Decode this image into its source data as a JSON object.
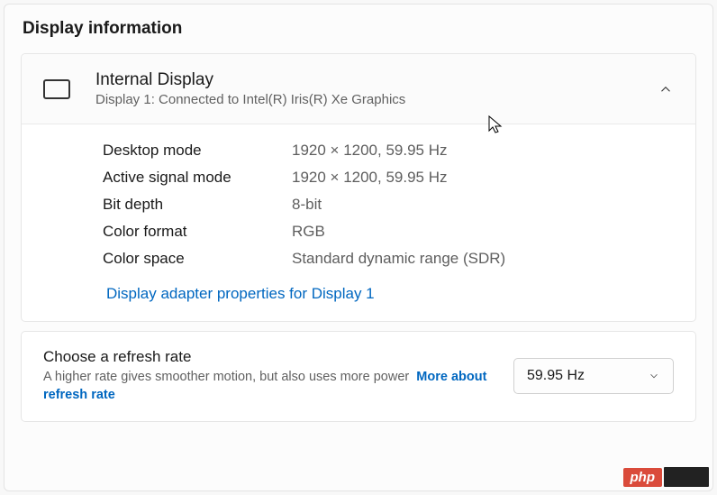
{
  "section_title": "Display information",
  "display": {
    "title": "Internal Display",
    "subtitle": "Display 1: Connected to Intel(R) Iris(R) Xe Graphics",
    "properties": [
      {
        "label": "Desktop mode",
        "value": "1920 × 1200, 59.95 Hz"
      },
      {
        "label": "Active signal mode",
        "value": "1920 × 1200, 59.95 Hz"
      },
      {
        "label": "Bit depth",
        "value": "8-bit"
      },
      {
        "label": "Color format",
        "value": "RGB"
      },
      {
        "label": "Color space",
        "value": "Standard dynamic range (SDR)"
      }
    ],
    "adapter_link": "Display adapter properties for Display 1"
  },
  "refresh": {
    "title": "Choose a refresh rate",
    "description": "A higher rate gives smoother motion, but also uses more power",
    "more_link": "More about refresh rate",
    "selected": "59.95 Hz"
  },
  "watermark": {
    "text": "php"
  }
}
